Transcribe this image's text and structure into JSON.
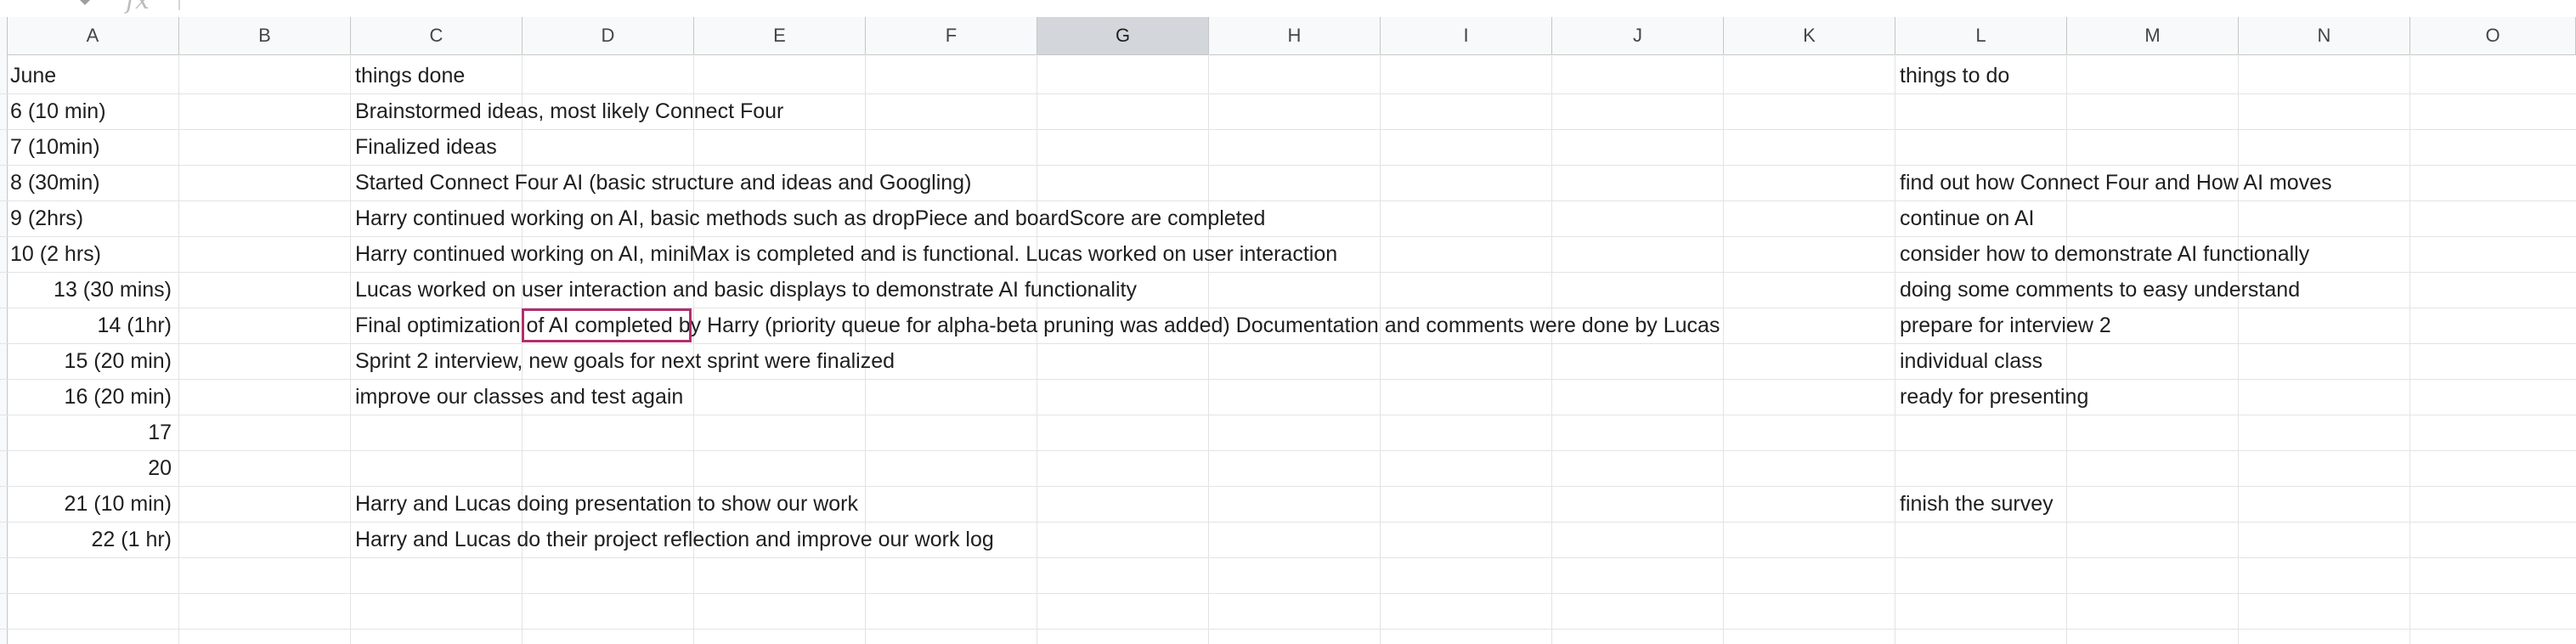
{
  "columns": [
    "A",
    "B",
    "C",
    "D",
    "E",
    "F",
    "G",
    "H",
    "I",
    "J",
    "K",
    "L",
    "M",
    "N",
    "O"
  ],
  "selected_column": "G",
  "formula_bar": {
    "icon": "fx-icon"
  },
  "rows": [
    {
      "a": "June",
      "c": "things done",
      "l": "things to do"
    },
    {
      "a": "6 (10 min)",
      "c": "Brainstormed ideas, most likely Connect Four",
      "l": ""
    },
    {
      "a": "7 (10min)",
      "c": "Finalized ideas",
      "l": ""
    },
    {
      "a": "8 (30min)",
      "c": "Started Connect Four AI (basic structure and ideas and Googling)",
      "l": "find out how Connect Four and How AI moves"
    },
    {
      "a": "9 (2hrs)",
      "c": "Harry continued working on AI, basic methods such as dropPiece and boardScore are completed",
      "l": "continue on AI"
    },
    {
      "a": "10 (2 hrs)",
      "c": "Harry continued working on AI, miniMax is completed and is functional. Lucas worked on user interaction",
      "l": "consider how to demonstrate AI functionally"
    },
    {
      "a": "13 (30 mins)",
      "c": "Lucas worked on user interaction and basic displays to demonstrate AI functionality",
      "l": "doing some comments to easy understand"
    },
    {
      "a": "14 (1hr)",
      "c": "Final optimization of AI completed by Harry (priority queue for alpha-beta pruning was added) Documentation and comments were done by Lucas",
      "l": "prepare for interview 2"
    },
    {
      "a": "15 (20 min)",
      "c": "Sprint 2 interview, new goals for next sprint were finalized",
      "l": "individual class"
    },
    {
      "a": "16 (20 min)",
      "c": "improve our classes and test again",
      "l": "ready for presenting"
    },
    {
      "a": "17",
      "c": "",
      "l": ""
    },
    {
      "a": "20",
      "c": "",
      "l": ""
    },
    {
      "a": "21 (10 min)",
      "c": "Harry and Lucas doing presentation to show our work",
      "l": "finish the survey"
    },
    {
      "a": "22 (1 hr)",
      "c": "Harry and Lucas do their project reflection and improve our work log",
      "l": ""
    }
  ],
  "colors": {
    "header_bg": "#f8f9fa",
    "selected_header_bg": "#d3d7dc",
    "gridline": "#e2e3e3",
    "selection_border": "#b0306e",
    "text": "#1f1f1f"
  }
}
